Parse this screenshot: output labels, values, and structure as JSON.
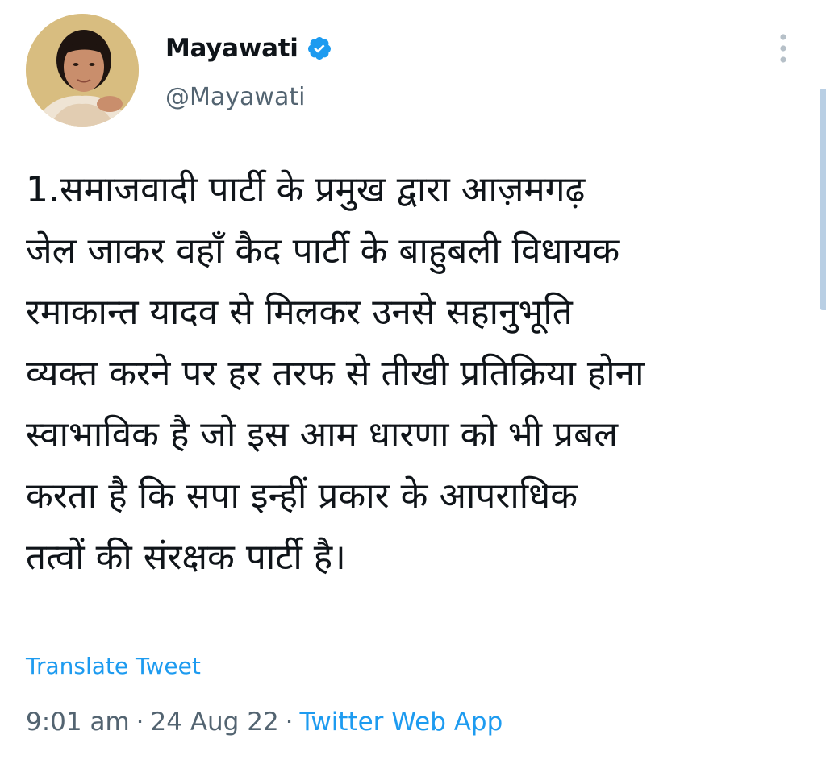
{
  "author": {
    "display_name": "Mayawati",
    "handle": "@Mayawati",
    "verified": true,
    "avatar_icon": "profile-photo"
  },
  "tweet": {
    "text": "1.समाजवादी पार्टी के प्रमुख द्वारा आज़मगढ़\nजेल जाकर वहाँ कैद पार्टी के बाहुबली विधायक\nरमाकान्त यादव से मिलकर उनसे सहानुभूति\nव्यक्त करने पर हर तरफ से तीखी प्रतिक्रिया होना\nस्वाभाविक है जो इस आम धारणा को भी प्रबल\nकरता है कि सपा इन्हीं प्रकार के आपराधिक\nतत्वों की संरक्षक पार्टी है।",
    "translate_label": "Translate Tweet",
    "time": "9:01 am",
    "separator": "·",
    "date": "24 Aug 22",
    "source": "Twitter Web App"
  },
  "colors": {
    "link": "#1d9bf0",
    "secondary_text": "#536471",
    "primary_text": "#0f1419",
    "verified_badge": "#1d9bf0"
  },
  "icons": {
    "verified": "verified-badge-icon",
    "more": "more-vertical-icon"
  }
}
